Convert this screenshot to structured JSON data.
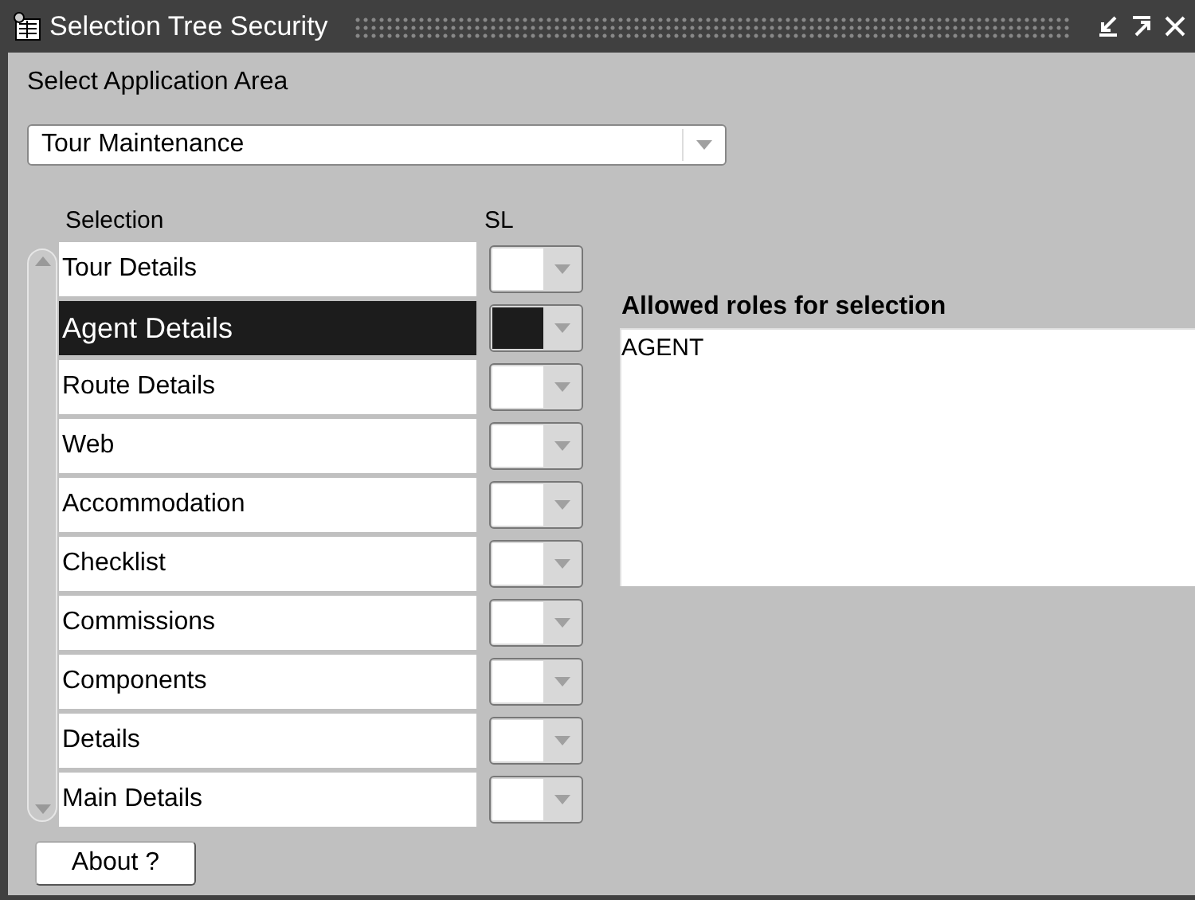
{
  "window": {
    "title": "Selection Tree Security"
  },
  "application_area": {
    "label": "Select Application Area",
    "value": "Tour Maintenance"
  },
  "selection_table": {
    "columns": [
      "Selection",
      "SL"
    ],
    "rows": [
      {
        "label": "Tour Details",
        "selected": false
      },
      {
        "label": "Agent Details",
        "selected": true
      },
      {
        "label": "Route Details",
        "selected": false
      },
      {
        "label": "Web",
        "selected": false
      },
      {
        "label": "Accommodation",
        "selected": false
      },
      {
        "label": "Checklist",
        "selected": false
      },
      {
        "label": "Commissions",
        "selected": false
      },
      {
        "label": "Components",
        "selected": false
      },
      {
        "label": "Details",
        "selected": false
      },
      {
        "label": "Main Details",
        "selected": false
      }
    ]
  },
  "roles": {
    "label": "Allowed roles for selection",
    "items": [
      "AGENT"
    ]
  },
  "buttons": [
    "About ?"
  ]
}
